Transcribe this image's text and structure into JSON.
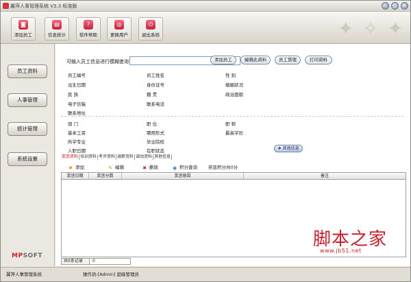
{
  "window": {
    "title": "翼萍人事管理系统 V3.3  标准版",
    "min_label": "–",
    "max_label": "□",
    "close_label": "×"
  },
  "toolbar": {
    "buttons": [
      {
        "label": "添加员工",
        "icon": "add-user-icon",
        "glyph": "◙"
      },
      {
        "label": "信息统计",
        "icon": "stats-icon",
        "glyph": "▤"
      },
      {
        "label": "软件帮助",
        "icon": "help-icon",
        "glyph": "?"
      },
      {
        "label": "更换用户",
        "icon": "switch-user-icon",
        "glyph": "◎"
      },
      {
        "label": "退出系统",
        "icon": "exit-icon",
        "glyph": "⏻"
      }
    ]
  },
  "sidebar": {
    "items": [
      {
        "label": "员工资料"
      },
      {
        "label": "人事管理"
      },
      {
        "label": "统计管理"
      },
      {
        "label": "系统设置"
      }
    ],
    "logo": {
      "prefix": "MP",
      "suffix": "SOFT"
    }
  },
  "query": {
    "label": "可输入员工信息进行模糊查询",
    "placeholder": "",
    "value": ""
  },
  "actions": {
    "add_employee": "添加员工",
    "edit": "编辑此资料",
    "manage": "员工管理",
    "print": "打印资料"
  },
  "fields": {
    "row1": [
      "员工编号",
      "员工姓名",
      "性    别"
    ],
    "row2": [
      "出生日期",
      "身份证号",
      "婚姻状况"
    ],
    "row3": [
      "民    族",
      "籍    贯",
      "政治面貌"
    ],
    "row4": [
      "电子信箱",
      "联系电话"
    ],
    "row5": [
      "联系地址"
    ],
    "row6": [
      "部    门",
      "职    位",
      "职    称"
    ],
    "row7": [
      "基本工资",
      "聘用形式",
      "最高学历"
    ],
    "row8": [
      "所学专业",
      "毕业院校"
    ],
    "row9": [
      "入职日期",
      "在职状态"
    ]
  },
  "other_info": "其他信息",
  "tabs": [
    "奖惩资料",
    "培训资料",
    "考评资料",
    "调薪资料",
    "调动资料",
    "其他信息"
  ],
  "record_actions": {
    "add": "添加",
    "edit": "编辑",
    "delete": "删除",
    "query": "积分查询",
    "total": "奖惩积分共0分"
  },
  "grid": {
    "columns": [
      "奖惩日期",
      "奖惩分数",
      "奖惩原因",
      "备注"
    ],
    "rows": []
  },
  "footer": {
    "count_label": "共0条记录",
    "count_value": "0"
  },
  "status": {
    "system": "翼萍人事管理系统",
    "operator": "操作员:[Admin] 超级管理员"
  },
  "watermark": {
    "main": "脚本之家",
    "url": "www.jb51.net"
  },
  "colors": {
    "accent": "#b4202e",
    "tool_icon": "#d43a52"
  }
}
